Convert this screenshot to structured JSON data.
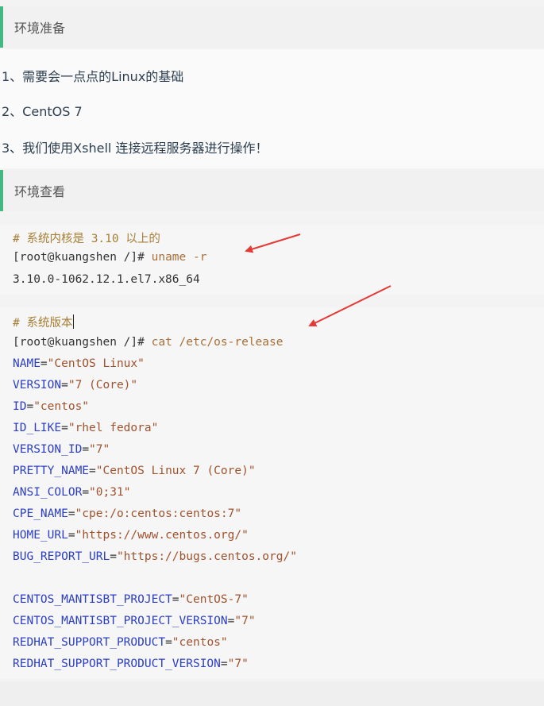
{
  "section1": {
    "title": "环境准备"
  },
  "requirements": [
    "1、需要会一点点的Linux的基础",
    "2、CentOS 7",
    "3、我们使用Xshell 连接远程服务器进行操作！"
  ],
  "section2": {
    "title": "环境查看"
  },
  "code1": {
    "comment": "# 系统内核是 3.10 以上的",
    "prompt": "[root@kuangshen /]# ",
    "command": "uname -r",
    "output": "3.10.0-1062.12.1.el7.x86_64"
  },
  "code2": {
    "comment": "# 系统版本",
    "prompt": "[root@kuangshen /]# ",
    "command": "cat /etc/os-release",
    "lines": [
      {
        "key": "NAME",
        "value": "\"CentOS Linux\""
      },
      {
        "key": "VERSION",
        "value": "\"7 (Core)\""
      },
      {
        "key": "ID",
        "value": "\"centos\""
      },
      {
        "key": "ID_LIKE",
        "value": "\"rhel fedora\""
      },
      {
        "key": "VERSION_ID",
        "value": "\"7\""
      },
      {
        "key": "PRETTY_NAME",
        "value": "\"CentOS Linux 7 (Core)\""
      },
      {
        "key": "ANSI_COLOR",
        "value": "\"0;31\""
      },
      {
        "key": "CPE_NAME",
        "value": "\"cpe:/o:centos:centos:7\""
      },
      {
        "key": "HOME_URL",
        "value": "\"https://www.centos.org/\""
      },
      {
        "key": "BUG_REPORT_URL",
        "value": "\"https://bugs.centos.org/\""
      },
      {
        "key": "CENTOS_MANTISBT_PROJECT",
        "value": "\"CentOS-7\""
      },
      {
        "key": "CENTOS_MANTISBT_PROJECT_VERSION",
        "value": "\"7\""
      },
      {
        "key": "REDHAT_SUPPORT_PRODUCT",
        "value": "\"centos\""
      },
      {
        "key": "REDHAT_SUPPORT_PRODUCT_VERSION",
        "value": "\"7\""
      }
    ]
  },
  "colors": {
    "accent": "#42b983",
    "arrow": "#e53935",
    "key": "#2b3ec6",
    "value": "#a0522d",
    "comment": "#a87f36"
  }
}
